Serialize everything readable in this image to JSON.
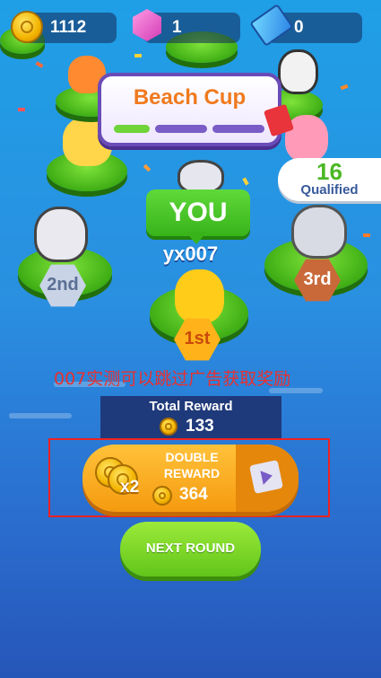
{
  "hud": {
    "coins": "1112",
    "gems": "1",
    "tickets": "0"
  },
  "banner": {
    "title": "Beach Cup"
  },
  "qualified": {
    "count": "16",
    "label": "Qualified"
  },
  "player": {
    "you_label": "YOU",
    "name": "yx007"
  },
  "podium": {
    "first": "1st",
    "second": "2nd",
    "third": "3rd"
  },
  "overlay_text": "007实测可以跳过广告获取奖励",
  "reward": {
    "title": "Total Reward",
    "value": "133"
  },
  "double_reward": {
    "line1": "DOUBLE",
    "line2": "REWARD",
    "multiplier": "x2",
    "value": "364"
  },
  "next_round": {
    "label": "NEXT ROUND"
  },
  "colors": {
    "accent_green": "#38b31a",
    "accent_orange": "#f59a0f",
    "banner_border": "#6a4bb8"
  },
  "icons": [
    "coin-icon",
    "gem-icon",
    "ticket-icon",
    "video-ad-icon"
  ]
}
